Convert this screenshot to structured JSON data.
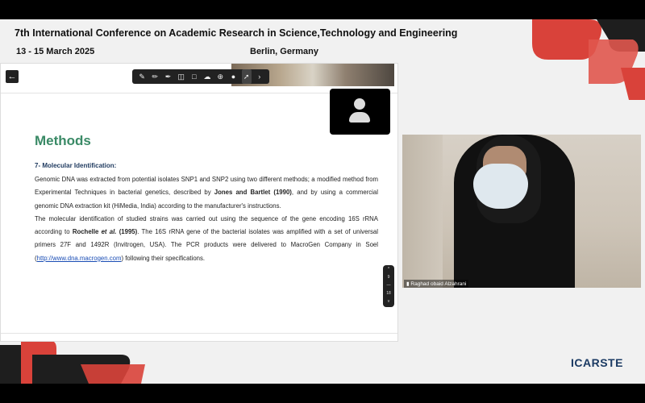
{
  "conference": {
    "title": "7th International Conference on Academic Research in Science,Technology and Engineering",
    "date": "13 - 15 March 2025",
    "location": "Berlin, Germany",
    "logo_text": "ICARSTE"
  },
  "colors": {
    "accent_red": "#d9423a",
    "dark": "#1e1e1e",
    "methods_green": "#3a8a66"
  },
  "viewer": {
    "back_icon": "arrow-left-icon",
    "tools": [
      "pen-icon",
      "marker-icon",
      "highlighter-icon",
      "eraser-icon",
      "shapes-icon",
      "cloud-icon",
      "add-icon",
      "mic-icon",
      "laser-pointer-icon",
      "chevron-right-icon"
    ],
    "pager": {
      "up": "^",
      "page": "9",
      "sep": "—",
      "total": "18",
      "down": "v"
    }
  },
  "slide": {
    "heading": "Methods",
    "subheading": "7- Molecular Identification:",
    "p1a": "Genomic DNA was extracted from potential isolates SNP1 and SNP2 using two different methods; a modified method from Experimental Techniques in bacterial genetics, described by ",
    "p1b": "Jones and Bartlet (1990)",
    "p1c": ", and by using a commercial genomic DNA extraction kit (HiMedia, India) according to the manufacturer's instructions.",
    "p2a": "The molecular identification of studied strains was carried out using the sequence of the gene encoding 16S rRNA according to ",
    "p2b": "Rochelle ",
    "p2c": "et al.",
    "p2d": " (1995)",
    "p2e": ". The 16S rRNA gene of the bacterial isolates was amplified with a set of universal primers 27F and 1492R (Invitrogen, USA). The PCR products were delivered to MacroGen Company in Soel (",
    "p2link": "http://www.dna.macrogen.com",
    "p2f": ") following their specifications."
  },
  "participants": {
    "speaker_name": "Raghad obaid Alzahrani"
  }
}
